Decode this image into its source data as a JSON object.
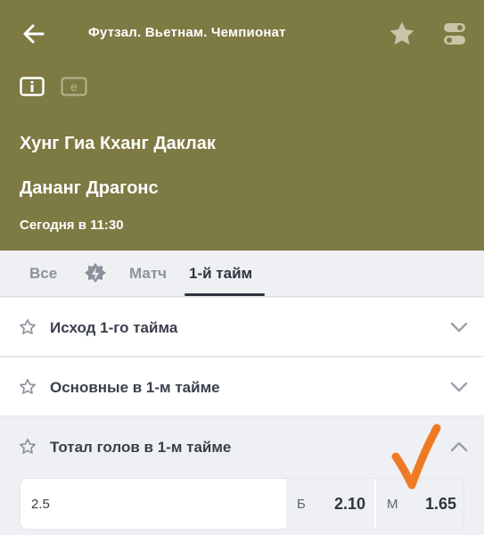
{
  "header": {
    "title": "Футзал. Вьетнам. Чемпионат",
    "team_home": "Хунг Гиа Кханг Даклак",
    "team_away": "Дананг Драгонс",
    "start_time": "Сегодня в 11:30",
    "icons": [
      "back-arrow-icon",
      "favorite-star-icon",
      "settings-toggle-icon",
      "info-screen-icon",
      "e-mode-icon"
    ],
    "background_color": "#7d7a43"
  },
  "tabs": [
    {
      "label": "Все",
      "active": false
    },
    {
      "icon": "live-lightning-icon",
      "active": false
    },
    {
      "label": "Матч",
      "active": false
    },
    {
      "label": "1-й тайм",
      "active": true
    }
  ],
  "sections": [
    {
      "label": "Исход 1-го тайма",
      "expanded": false
    },
    {
      "label": "Основные в 1-м тайме",
      "expanded": false
    },
    {
      "label": "Тотал голов в 1-м тайме",
      "expanded": true
    }
  ],
  "total_odds": {
    "line": "2.5",
    "over_label": "Б",
    "over_value": "2.10",
    "under_label": "М",
    "under_value": "1.65"
  },
  "annotation": {
    "color": "#f07a24",
    "icon": "orange-checkmark-annotation"
  }
}
